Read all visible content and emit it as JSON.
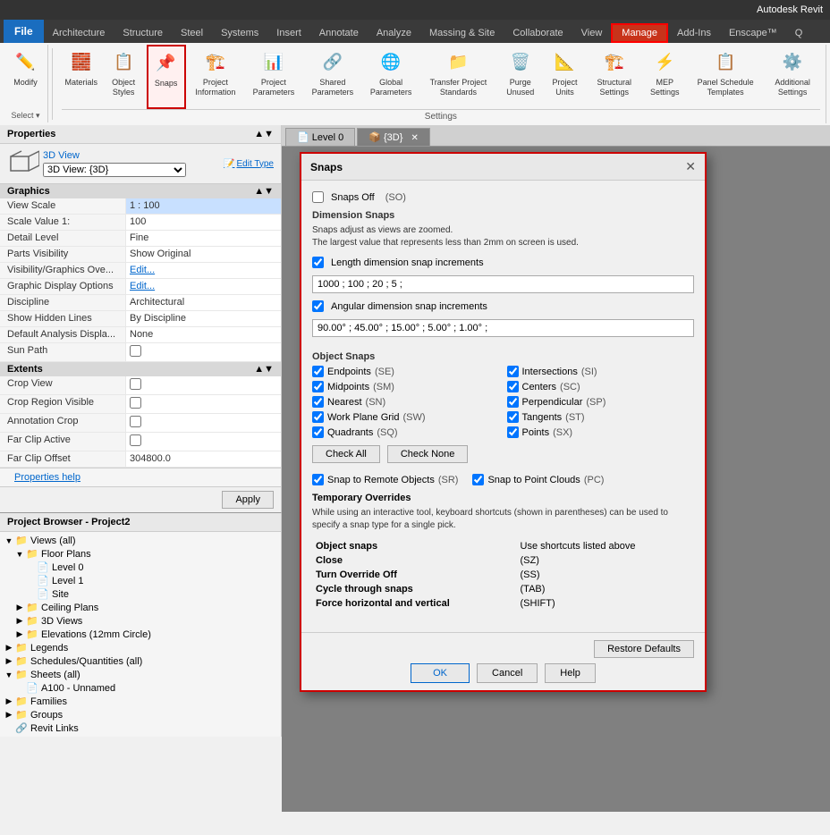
{
  "titlebar": {
    "text": "Autodesk Revit"
  },
  "ribbon": {
    "file_btn": "File",
    "tabs": [
      {
        "label": "Architecture",
        "active": false
      },
      {
        "label": "Structure",
        "active": false
      },
      {
        "label": "Steel",
        "active": false
      },
      {
        "label": "Systems",
        "active": false
      },
      {
        "label": "Insert",
        "active": false
      },
      {
        "label": "Annotate",
        "active": false
      },
      {
        "label": "Analyze",
        "active": false
      },
      {
        "label": "Massing & Site",
        "active": false
      },
      {
        "label": "Collaborate",
        "active": false
      },
      {
        "label": "View",
        "active": false
      },
      {
        "label": "Manage",
        "active": true,
        "highlight": true
      },
      {
        "label": "Add-Ins",
        "active": false
      },
      {
        "label": "Enscape™",
        "active": false
      },
      {
        "label": "Q",
        "active": false
      }
    ],
    "groups": {
      "settings_label": "Settings",
      "buttons": [
        {
          "icon": "✏️",
          "label": "Modify",
          "name": "modify-btn"
        },
        {
          "icon": "🧱",
          "label": "Materials",
          "name": "materials-btn"
        },
        {
          "icon": "📋",
          "label": "Object Styles",
          "name": "object-styles-btn"
        },
        {
          "icon": "📌",
          "label": "Snaps",
          "name": "snaps-btn",
          "highlighted": true
        },
        {
          "icon": "🏗️",
          "label": "Project Information",
          "name": "project-info-btn"
        },
        {
          "icon": "📊",
          "label": "Project Parameters",
          "name": "project-params-btn"
        },
        {
          "icon": "🔗",
          "label": "Shared Parameters",
          "name": "shared-params-btn"
        },
        {
          "icon": "🌐",
          "label": "Global Parameters",
          "name": "global-params-btn"
        },
        {
          "icon": "📁",
          "label": "Transfer Project Standards",
          "name": "transfer-btn"
        },
        {
          "icon": "🗑️",
          "label": "Purge Unused",
          "name": "purge-btn"
        },
        {
          "icon": "📐",
          "label": "Project Units",
          "name": "project-units-btn"
        },
        {
          "icon": "🏗️",
          "label": "Structural Settings",
          "name": "structural-settings-btn"
        },
        {
          "icon": "⚡",
          "label": "MEP Settings",
          "name": "mep-settings-btn"
        },
        {
          "icon": "📋",
          "label": "Panel Schedule Templates",
          "name": "panel-schedule-btn"
        },
        {
          "icon": "⚙️",
          "label": "Additional Settings",
          "name": "additional-settings-btn"
        }
      ]
    }
  },
  "properties": {
    "header": "Properties",
    "type_name": "3D View",
    "view_name": "3D View: {3D}",
    "edit_type_label": "Edit Type",
    "section_graphics": "Graphics",
    "rows": [
      {
        "label": "View Scale",
        "value": "1 : 100",
        "highlight": true
      },
      {
        "label": "Scale Value 1:",
        "value": "100"
      },
      {
        "label": "Detail Level",
        "value": "Fine"
      },
      {
        "label": "Parts Visibility",
        "value": "Show Original"
      },
      {
        "label": "Visibility/Graphics Ove...",
        "value": "Edit...",
        "link": true
      },
      {
        "label": "Graphic Display Options",
        "value": "Edit...",
        "link": true
      },
      {
        "label": "Discipline",
        "value": "Architectural"
      },
      {
        "label": "Show Hidden Lines",
        "value": "By Discipline"
      },
      {
        "label": "Default Analysis Displa...",
        "value": "None"
      },
      {
        "label": "Sun Path",
        "value": "checkbox"
      }
    ],
    "section_extents": "Extents",
    "extent_rows": [
      {
        "label": "Crop View",
        "value": "checkbox"
      },
      {
        "label": "Crop Region Visible",
        "value": "checkbox"
      },
      {
        "label": "Annotation Crop",
        "value": "checkbox"
      },
      {
        "label": "Far Clip Active",
        "value": "checkbox"
      },
      {
        "label": "Far Clip Offset",
        "value": "304800.0"
      }
    ],
    "help_label": "Properties help",
    "apply_label": "Apply"
  },
  "browser": {
    "header": "Project Browser - Project2",
    "tree": [
      {
        "level": 0,
        "label": "Views (all)",
        "expanded": true,
        "icon": "📁"
      },
      {
        "level": 1,
        "label": "Floor Plans",
        "expanded": true,
        "icon": "📁"
      },
      {
        "level": 2,
        "label": "Level 0",
        "icon": "📄"
      },
      {
        "level": 2,
        "label": "Level 1",
        "icon": "📄"
      },
      {
        "level": 2,
        "label": "Site",
        "icon": "📄"
      },
      {
        "level": 1,
        "label": "Ceiling Plans",
        "expanded": false,
        "icon": "📁"
      },
      {
        "level": 1,
        "label": "3D Views",
        "expanded": false,
        "icon": "📁"
      },
      {
        "level": 1,
        "label": "Elevations (12mm Circle)",
        "expanded": false,
        "icon": "📁"
      },
      {
        "level": 0,
        "label": "Legends",
        "expanded": false,
        "icon": "📁"
      },
      {
        "level": 0,
        "label": "Schedules/Quantities (all)",
        "expanded": false,
        "icon": "📁"
      },
      {
        "level": 0,
        "label": "Sheets (all)",
        "expanded": true,
        "icon": "📁"
      },
      {
        "level": 1,
        "label": "A100 - Unnamed",
        "icon": "📄"
      },
      {
        "level": 0,
        "label": "Families",
        "expanded": false,
        "icon": "📁"
      },
      {
        "level": 0,
        "label": "Groups",
        "expanded": false,
        "icon": "📁"
      },
      {
        "level": 0,
        "label": "Revit Links",
        "icon": "🔗"
      }
    ]
  },
  "view_tabs": [
    {
      "label": "Level 0"
    },
    {
      "label": "{3D}",
      "active": true,
      "closeable": true
    }
  ],
  "snaps_dialog": {
    "title": "Snaps",
    "snaps_off_label": "Snaps Off",
    "snaps_off_shortcut": "(SO)",
    "dim_snaps_title": "Dimension Snaps",
    "dim_snaps_note1": "Snaps adjust as views are zoomed.",
    "dim_snaps_note2": "The largest value that represents less than 2mm on screen is used.",
    "length_label": "Length dimension snap increments",
    "length_value": "1000 ; 100 ; 20 ; 5 ;",
    "angular_label": "Angular dimension snap increments",
    "angular_value": "90.00° ; 45.00° ; 15.00° ; 5.00° ; 1.00° ;",
    "object_snaps_title": "Object Snaps",
    "snaps": [
      {
        "label": "Endpoints",
        "shortcut": "(SE)",
        "checked": true
      },
      {
        "label": "Intersections",
        "shortcut": "(SI)",
        "checked": true
      },
      {
        "label": "Midpoints",
        "shortcut": "(SM)",
        "checked": true
      },
      {
        "label": "Centers",
        "shortcut": "(SC)",
        "checked": true
      },
      {
        "label": "Nearest",
        "shortcut": "(SN)",
        "checked": true
      },
      {
        "label": "Perpendicular",
        "shortcut": "(SP)",
        "checked": true
      },
      {
        "label": "Work Plane Grid",
        "shortcut": "(SW)",
        "checked": true
      },
      {
        "label": "Tangents",
        "shortcut": "(ST)",
        "checked": true
      },
      {
        "label": "Quadrants",
        "shortcut": "(SQ)",
        "checked": true
      },
      {
        "label": "Points",
        "shortcut": "(SX)",
        "checked": true
      }
    ],
    "check_all_label": "Check All",
    "check_none_label": "Check None",
    "snap_to_remote_label": "Snap to Remote Objects",
    "snap_to_remote_shortcut": "(SR)",
    "snap_to_remote_checked": true,
    "snap_to_clouds_label": "Snap to Point Clouds",
    "snap_to_clouds_shortcut": "(PC)",
    "snap_to_clouds_checked": true,
    "temp_overrides_title": "Temporary Overrides",
    "temp_overrides_note": "While using an interactive tool, keyboard shortcuts (shown in parentheses) can be used to specify a snap type for a single pick.",
    "overrides": [
      {
        "col1": "Object snaps",
        "col2": "Use shortcuts listed above"
      },
      {
        "col1": "Close",
        "col2": "(SZ)"
      },
      {
        "col1": "Turn Override Off",
        "col2": "(SS)"
      },
      {
        "col1": "Cycle through snaps",
        "col2": "(TAB)"
      },
      {
        "col1": "Force horizontal and vertical",
        "col2": "(SHIFT)"
      }
    ],
    "restore_defaults_label": "Restore Defaults",
    "ok_label": "OK",
    "cancel_label": "Cancel",
    "help_label": "Help"
  }
}
